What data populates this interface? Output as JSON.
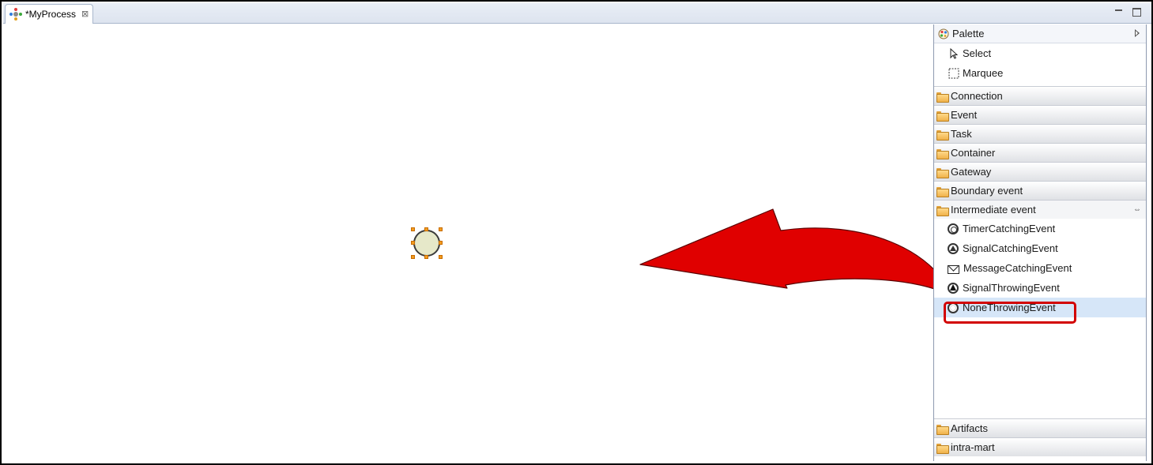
{
  "editor": {
    "tab_title": "*MyProcess",
    "tab_close": "⊠"
  },
  "palette": {
    "title": "Palette",
    "tools": [
      {
        "label": "Select",
        "icon": "arrow-cursor-icon"
      },
      {
        "label": "Marquee",
        "icon": "marquee-icon"
      }
    ],
    "drawers": [
      "Connection",
      "Event",
      "Task",
      "Container",
      "Gateway",
      "Boundary event"
    ],
    "open_drawer": {
      "label": "Intermediate event",
      "pin": "⇔",
      "items": [
        {
          "label": "TimerCatchingEvent",
          "icon": "timer-catching-event-icon"
        },
        {
          "label": "SignalCatchingEvent",
          "icon": "signal-catching-event-icon"
        },
        {
          "label": "MessageCatchingEvent",
          "icon": "message-catching-event-icon"
        },
        {
          "label": "SignalThrowingEvent",
          "icon": "signal-throwing-event-icon"
        },
        {
          "label": "NoneThrowingEvent",
          "icon": "none-throwing-event-icon",
          "selected": true
        }
      ]
    },
    "bottom_drawers": [
      "Artifacts",
      "intra-mart"
    ]
  },
  "colors": {
    "annotation_arrow": "#e00000",
    "highlight_box": "#d20000",
    "handle": "#f39c1e",
    "node_fill": "#e6e8c9",
    "selected_item": "#d6e6f8"
  }
}
